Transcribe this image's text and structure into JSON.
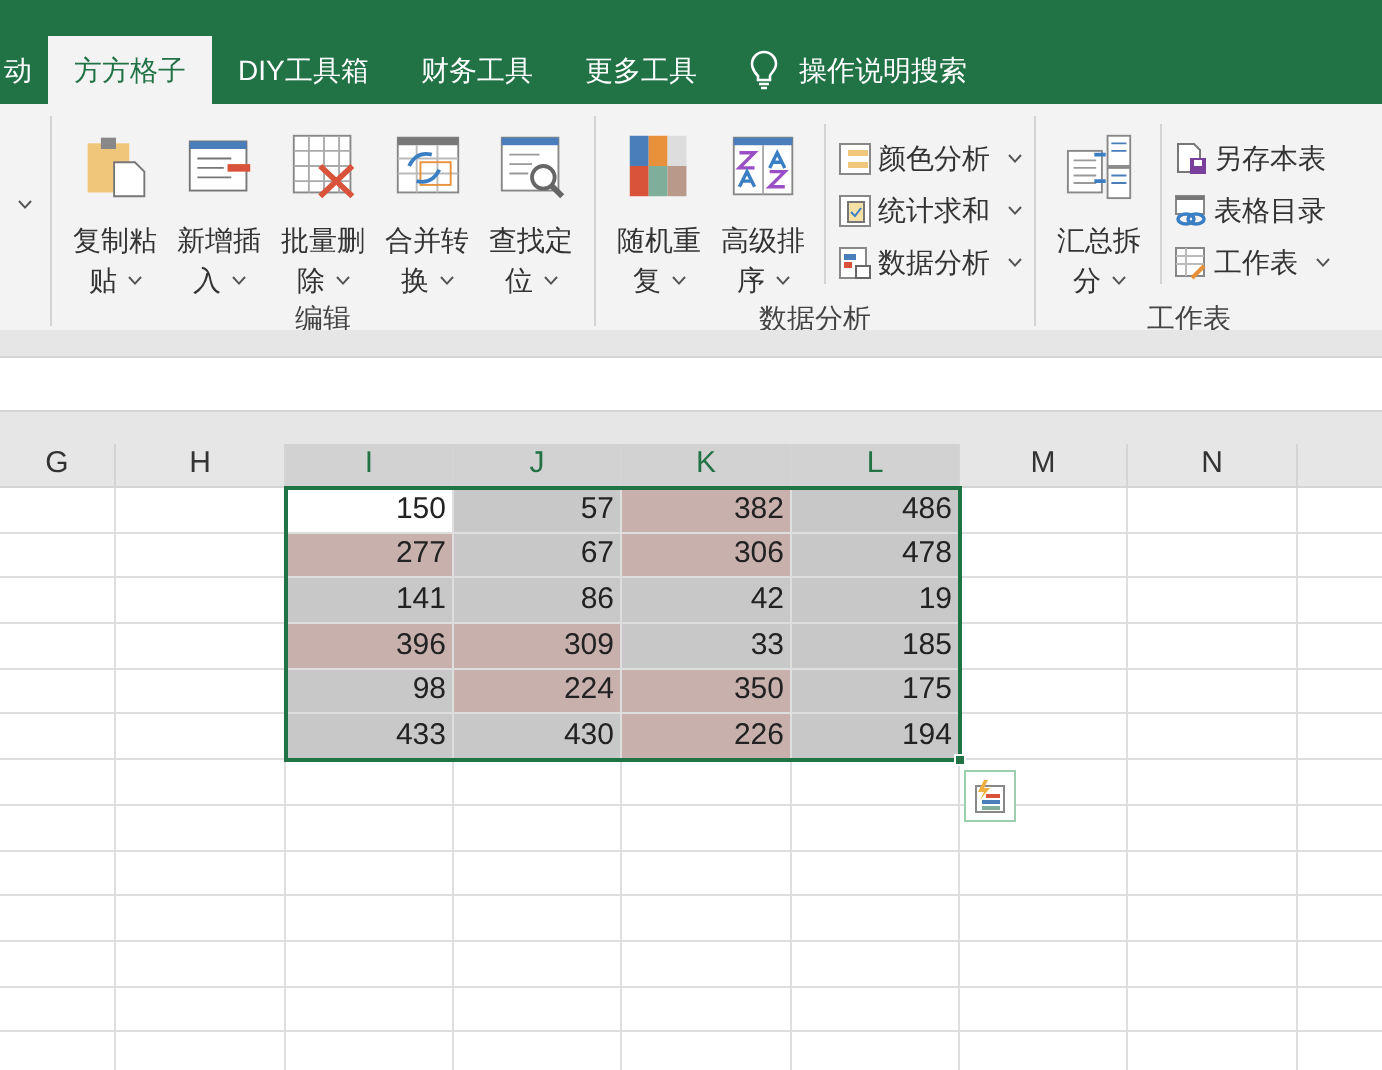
{
  "tabs": [
    {
      "label": "动",
      "selected": false
    },
    {
      "label": "方方格子",
      "selected": true
    },
    {
      "label": "DIY工具箱",
      "selected": false
    },
    {
      "label": "财务工具",
      "selected": false
    },
    {
      "label": "更多工具",
      "selected": false
    }
  ],
  "search": {
    "placeholder": "操作说明搜索"
  },
  "ribbon": {
    "groups": [
      {
        "label": "编辑",
        "items": [
          {
            "kind": "large",
            "lines": [
              "复制粘",
              "贴"
            ],
            "dropdown": true
          },
          {
            "kind": "large",
            "lines": [
              "新增插",
              "入"
            ],
            "dropdown": true
          },
          {
            "kind": "large",
            "lines": [
              "批量删",
              "除"
            ],
            "dropdown": true
          },
          {
            "kind": "large",
            "lines": [
              "合并转",
              "换"
            ],
            "dropdown": true
          },
          {
            "kind": "large",
            "lines": [
              "查找定",
              "位"
            ],
            "dropdown": true
          }
        ]
      },
      {
        "label": "数据分析",
        "items": [
          {
            "kind": "large",
            "lines": [
              "随机重",
              "复"
            ],
            "dropdown": true
          },
          {
            "kind": "large",
            "lines": [
              "高级排",
              "序"
            ],
            "dropdown": true
          },
          {
            "kind": "small",
            "label": "颜色分析",
            "dropdown": true
          },
          {
            "kind": "small",
            "label": "统计求和",
            "dropdown": true
          },
          {
            "kind": "small",
            "label": "数据分析",
            "dropdown": true
          }
        ]
      },
      {
        "label": "工作表",
        "items": [
          {
            "kind": "large",
            "lines": [
              "汇总拆",
              "分"
            ],
            "dropdown": true
          },
          {
            "kind": "small",
            "label": "另存本表",
            "dropdown": false
          },
          {
            "kind": "small",
            "label": "表格目录",
            "dropdown": false
          },
          {
            "kind": "small",
            "label": "工作表",
            "dropdown": true
          }
        ]
      }
    ]
  },
  "sheet": {
    "columns": [
      {
        "label": "G",
        "selected": false
      },
      {
        "label": "H",
        "selected": false
      },
      {
        "label": "I",
        "selected": true
      },
      {
        "label": "J",
        "selected": true
      },
      {
        "label": "K",
        "selected": true
      },
      {
        "label": "L",
        "selected": true
      },
      {
        "label": "M",
        "selected": false
      },
      {
        "label": "N",
        "selected": false
      }
    ],
    "rows": [
      [
        {
          "value": "150",
          "color": "#ffffff"
        },
        {
          "value": "57",
          "color": "#c8c8c8"
        },
        {
          "value": "382",
          "color": "#c8b0ad"
        },
        {
          "value": "486",
          "color": "#c8c8c8"
        }
      ],
      [
        {
          "value": "277",
          "color": "#c8b0ad"
        },
        {
          "value": "67",
          "color": "#c8c8c8"
        },
        {
          "value": "306",
          "color": "#c8b0ad"
        },
        {
          "value": "478",
          "color": "#c8c8c8"
        }
      ],
      [
        {
          "value": "141",
          "color": "#c8c8c8"
        },
        {
          "value": "86",
          "color": "#c8c8c8"
        },
        {
          "value": "42",
          "color": "#c8c8c8"
        },
        {
          "value": "19",
          "color": "#c8c8c8"
        }
      ],
      [
        {
          "value": "396",
          "color": "#c8b0ad"
        },
        {
          "value": "309",
          "color": "#c8b0ad"
        },
        {
          "value": "33",
          "color": "#c8c8c8"
        },
        {
          "value": "185",
          "color": "#c8c8c8"
        }
      ],
      [
        {
          "value": "98",
          "color": "#c8c8c8"
        },
        {
          "value": "224",
          "color": "#c8b0ad"
        },
        {
          "value": "350",
          "color": "#c8b0ad"
        },
        {
          "value": "175",
          "color": "#c8c8c8"
        }
      ],
      [
        {
          "value": "433",
          "color": "#c8c8c8"
        },
        {
          "value": "430",
          "color": "#c8c8c8"
        },
        {
          "value": "226",
          "color": "#c8b0ad"
        },
        {
          "value": "194",
          "color": "#c8c8c8"
        }
      ]
    ]
  }
}
